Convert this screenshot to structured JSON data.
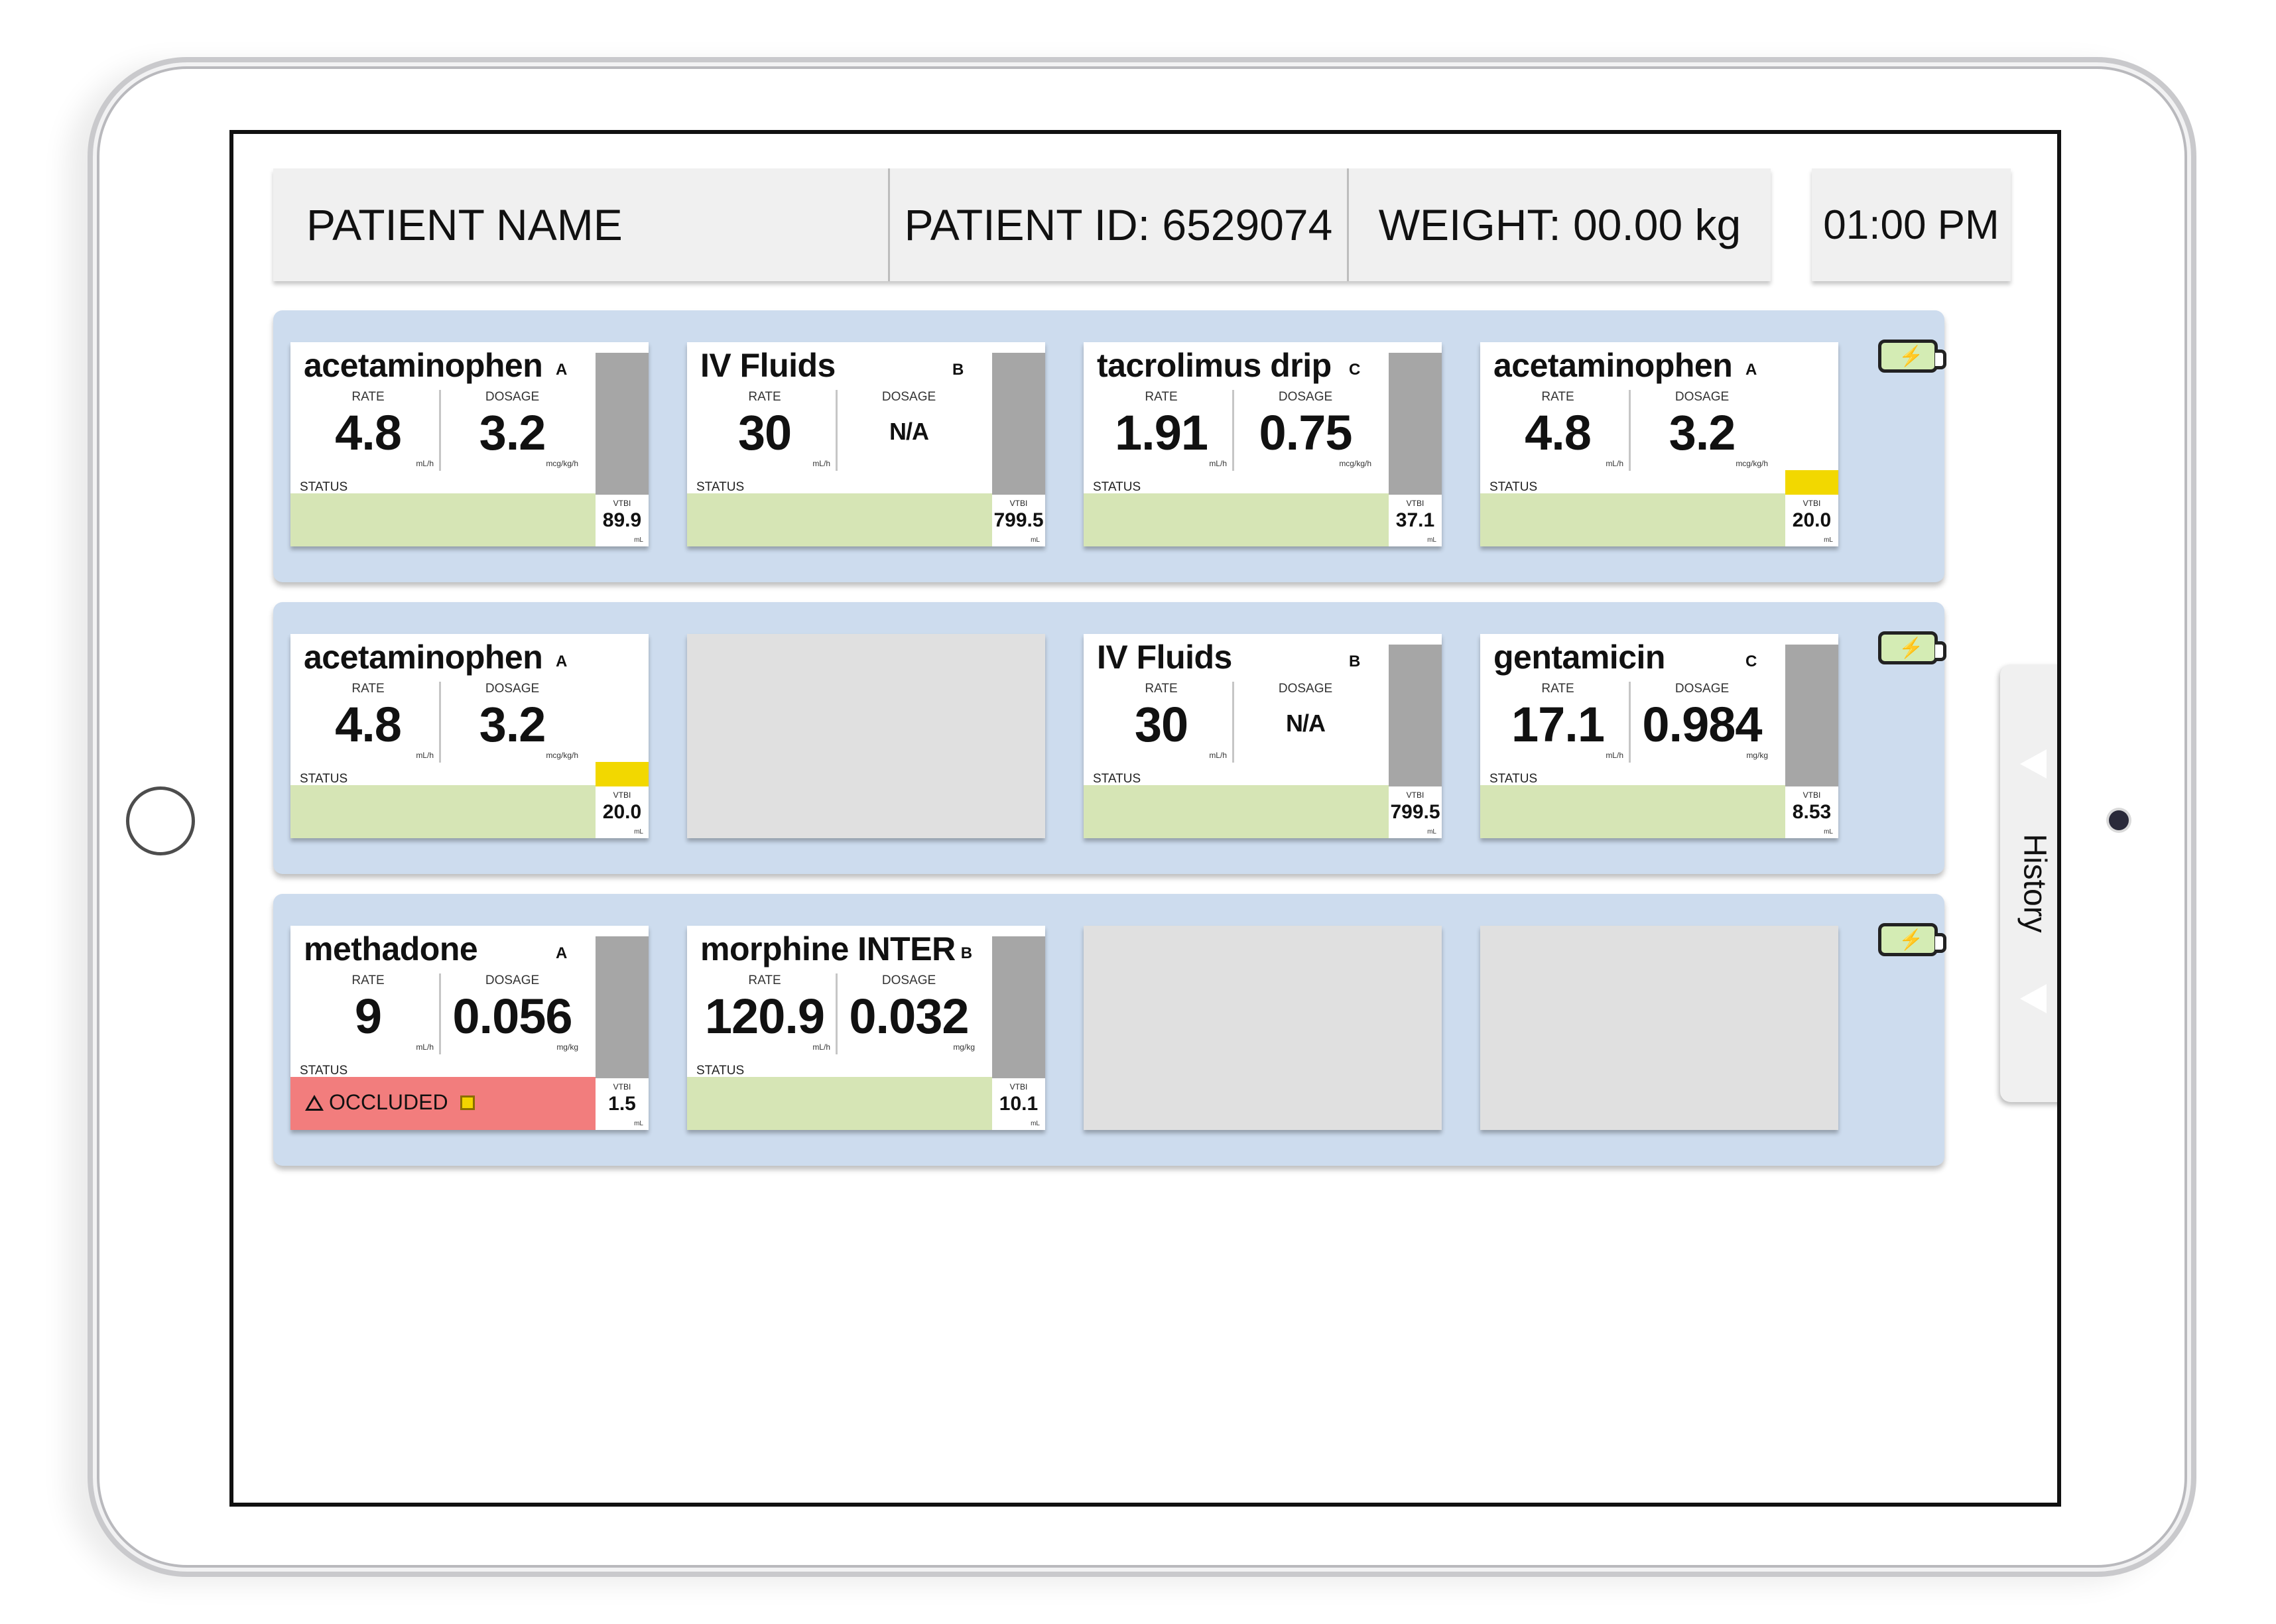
{
  "header": {
    "patient_name": "PATIENT NAME",
    "patient_id": "PATIENT ID: 6529074",
    "weight": "WEIGHT:  00.00 kg",
    "time": "01:00 PM"
  },
  "labels": {
    "rate": "RATE",
    "dosage": "DOSAGE",
    "status": "STATUS",
    "vtbi": "VTBI",
    "vtbi_unit": "mL"
  },
  "history": {
    "label": "History"
  },
  "rows": [
    {
      "battery_icon": "battery-charging-icon",
      "pumps": [
        {
          "name": "acetaminophen",
          "channel": "A",
          "rate": "4.8",
          "rate_unit": "mL/h",
          "dosage": "3.2",
          "dosage_unit": "mcg/kg/h",
          "status": "",
          "vtbi": "89.9",
          "volume_fraction": 0.93,
          "volume_low": false
        },
        {
          "name": "IV Fluids",
          "channel": "B",
          "rate": "30",
          "rate_unit": "mL/h",
          "dosage": "N/A",
          "dosage_unit": "",
          "status": "",
          "vtbi": "799.5",
          "volume_fraction": 0.93,
          "volume_low": false
        },
        {
          "name": "tacrolimus drip",
          "channel": "C",
          "rate": "1.91",
          "rate_unit": "mL/h",
          "dosage": "0.75",
          "dosage_unit": "mcg/kg/h",
          "status": "",
          "vtbi": "37.1",
          "volume_fraction": 0.93,
          "volume_low": false
        },
        {
          "name": "acetaminophen",
          "channel": "A",
          "rate": "4.8",
          "rate_unit": "mL/h",
          "dosage": "3.2",
          "dosage_unit": "mcg/kg/h",
          "status": "",
          "vtbi": "20.0",
          "volume_fraction": 0.16,
          "volume_low": true
        }
      ]
    },
    {
      "battery_icon": "battery-charging-icon",
      "pumps": [
        {
          "name": "acetaminophen",
          "channel": "A",
          "rate": "4.8",
          "rate_unit": "mL/h",
          "dosage": "3.2",
          "dosage_unit": "mcg/kg/h",
          "status": "",
          "vtbi": "20.0",
          "volume_fraction": 0.16,
          "volume_low": true
        },
        null,
        {
          "name": "IV Fluids",
          "channel": "B",
          "rate": "30",
          "rate_unit": "mL/h",
          "dosage": "N/A",
          "dosage_unit": "",
          "status": "",
          "vtbi": "799.5",
          "volume_fraction": 0.93,
          "volume_low": false
        },
        {
          "name": "gentamicin",
          "channel": "C",
          "rate": "17.1",
          "rate_unit": "mL/h",
          "dosage": "0.984",
          "dosage_unit": "mg/kg",
          "status": "",
          "vtbi": "8.53",
          "volume_fraction": 0.93,
          "volume_low": false
        }
      ]
    },
    {
      "battery_icon": "battery-charging-icon",
      "pumps": [
        {
          "name": "methadone",
          "channel": "A",
          "rate": "9",
          "rate_unit": "mL/h",
          "dosage": "0.056",
          "dosage_unit": "mg/kg",
          "status": "OCCLUDED",
          "alarm": true,
          "vtbi": "1.5",
          "volume_fraction": 0.93,
          "volume_low": false
        },
        {
          "name": "morphine INTER",
          "channel": "B",
          "rate": "120.9",
          "rate_unit": "mL/h",
          "dosage": "0.032",
          "dosage_unit": "mg/kg",
          "status": "",
          "vtbi": "10.1",
          "volume_fraction": 0.93,
          "volume_low": false
        },
        null,
        null
      ]
    }
  ],
  "colors": {
    "row_bg": "#cddcee",
    "status_ok": "#d6e5b5",
    "status_alarm": "#f27d7d",
    "volume_fill": "#a6a6a6",
    "volume_low": "#f2d800",
    "empty_slot": "#e0e0e0"
  }
}
